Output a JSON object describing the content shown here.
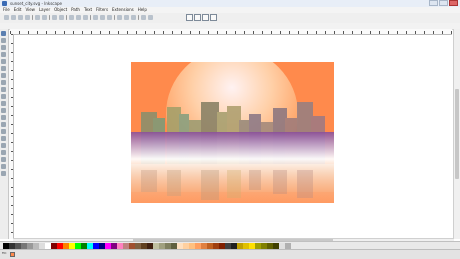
{
  "window": {
    "title": "sunset_city.svg - Inkscape"
  },
  "menu": [
    "File",
    "Edit",
    "View",
    "Layer",
    "Object",
    "Path",
    "Text",
    "Filters",
    "Extensions",
    "Help"
  ],
  "status": {
    "fill_label": "Fill:",
    "stroke_label": "Stroke:",
    "message": "",
    "coords": "",
    "zoom": ""
  },
  "palette_colors": [
    "#000000",
    "#333333",
    "#555555",
    "#777777",
    "#999999",
    "#bbbbbb",
    "#dddddd",
    "#ffffff",
    "#800000",
    "#ff0000",
    "#ff8000",
    "#ffff00",
    "#00ff00",
    "#008000",
    "#00ffff",
    "#0000ff",
    "#000080",
    "#ff00ff",
    "#800080",
    "#ff80c0",
    "#c08080",
    "#a05030",
    "#806040",
    "#604020",
    "#402010",
    "#c0c0a0",
    "#a0a080",
    "#808060",
    "#606040",
    "#ffe0c0",
    "#ffd0a0",
    "#ffc080",
    "#ffa060",
    "#e08040",
    "#c06020",
    "#a04010",
    "#802000",
    "#404040",
    "#202020",
    "#c0a000",
    "#e0c000",
    "#ffe000",
    "#a0a000",
    "#808000",
    "#606000",
    "#404000",
    "#e0e0e0",
    "#b0b0b0"
  ],
  "colors": {
    "sky_top": "#ff8a4c",
    "sun": "#ffd9b8",
    "haze": "#a04a90",
    "water": "#f6b07a"
  }
}
